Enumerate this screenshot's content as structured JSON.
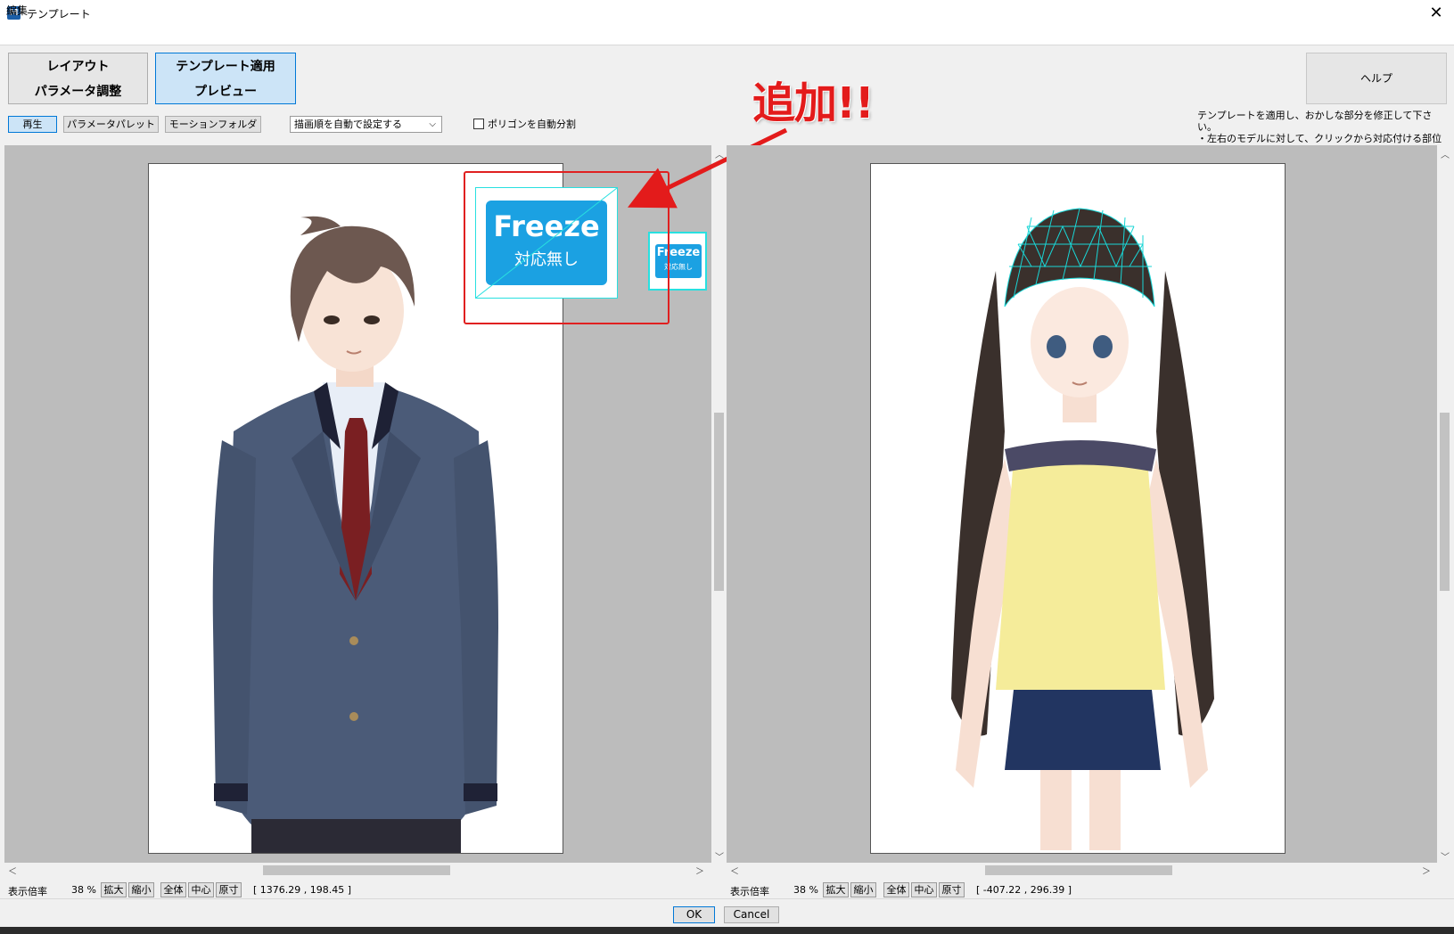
{
  "window": {
    "title": "テンプレート",
    "icon_letter": "M",
    "close_glyph": "✕"
  },
  "menu": {
    "edit": "編集"
  },
  "modes": {
    "layout": {
      "line1": "レイアウト",
      "line2": "パラメータ調整"
    },
    "template": {
      "line1": "テンプレート適用",
      "line2": "プレビュー"
    },
    "help": "ヘルプ"
  },
  "toolbar": {
    "play": "再生",
    "param_palette": "パラメータパレット",
    "motion_folder": "モーションフォルダ",
    "draw_order_select": "描画順を自動で設定する",
    "polygon_auto_split": "ポリゴンを自動分割"
  },
  "instructions": "テンプレートを適用し、おかしな部分を修正して下さい。\n・左右のモデルに対して、クリックから対応付ける部位を選び、\n「選択要素を対応付け」を押して下さい。",
  "annotation": {
    "text": "追加!!",
    "color": "#e31b1b"
  },
  "freeze_badge": {
    "title": "Freeze",
    "subtitle": "対応無し",
    "color": "#1ba1e2"
  },
  "left_status": {
    "zoom_label": "表示倍率",
    "zoom_value": "38 %",
    "zoom_in": "拡大",
    "zoom_out": "縮小",
    "fit": "全体",
    "center": "中心",
    "original": "原寸",
    "coords": "[ 1376.29 ,  198.45 ]"
  },
  "right_status": {
    "zoom_label": "表示倍率",
    "zoom_value": "38 %",
    "zoom_in": "拡大",
    "zoom_out": "縮小",
    "fit": "全体",
    "center": "中心",
    "original": "原寸",
    "coords": "[ -407.22 ,  296.39 ]"
  },
  "dialog": {
    "ok": "OK",
    "cancel": "Cancel"
  },
  "colors": {
    "selection": "#28e0e0",
    "mesh": "#19d6d6",
    "active_button": "#cce4f7"
  }
}
